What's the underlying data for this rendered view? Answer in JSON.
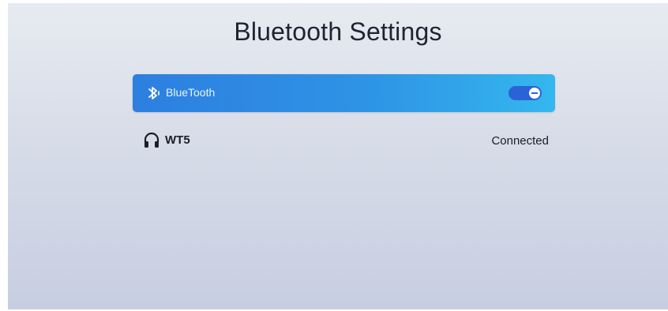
{
  "page": {
    "title": "Bluetooth Settings"
  },
  "bluetooth_toggle": {
    "label": "BlueTooth",
    "enabled": true,
    "icon": "bluetooth-icon",
    "accent_color": "#2e93e5"
  },
  "devices": [
    {
      "name": "WT5",
      "status": "Connected",
      "icon": "headphones-icon"
    }
  ]
}
